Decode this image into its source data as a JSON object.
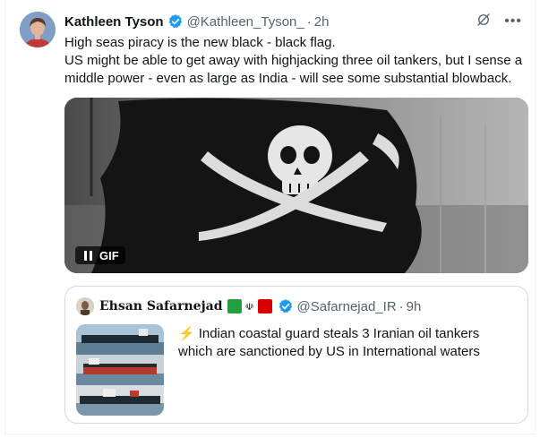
{
  "tweet": {
    "author_name": "Kathleen Tyson",
    "handle": "@Kathleen_Tyson_",
    "separator": "·",
    "time": "2h",
    "text_lines": [
      "High seas piracy is the new black - black flag.",
      "US might be able to get away with highjacking three oil tankers, but I sense a",
      "middle power - even as large as India - will see some substantial blowback."
    ],
    "more_label": "•••"
  },
  "media": {
    "badge_label": "GIF",
    "icon": "pause-icon"
  },
  "quote": {
    "author_name": "Ehsan Safarnejad",
    "handle": "@Safarnejad_IR",
    "separator": "·",
    "time": "9h",
    "emoji": "⚡",
    "text_lines": [
      "Indian coastal guard steals 3 Iranian oil tankers",
      "which are sanctioned by US in International waters"
    ],
    "flag_emblem": "☫"
  },
  "colors": {
    "verified": "#1d9bf0",
    "secondary_text": "#536471",
    "flag_green": "#239f40",
    "flag_red": "#da0000"
  }
}
